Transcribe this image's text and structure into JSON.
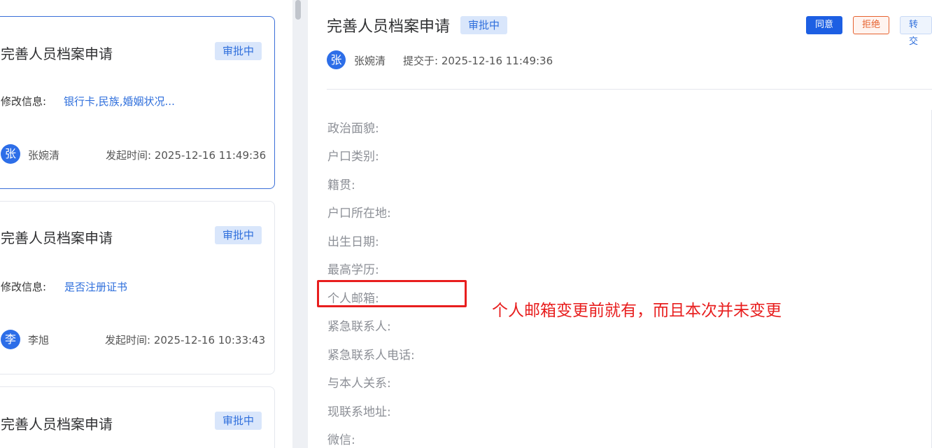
{
  "cards": [
    {
      "title": "完善人员档案申请",
      "status": "审批中",
      "info_label": "修改信息:",
      "info_value": "银行卡,民族,婚姻状况...",
      "avatar_char": "张",
      "name": "张婉清",
      "time": "发起时间: 2025-12-16 11:49:36"
    },
    {
      "title": "完善人员档案申请",
      "status": "审批中",
      "info_label": "修改信息:",
      "info_value": "是否注册证书",
      "avatar_char": "李",
      "name": "李旭",
      "time": "发起时间: 2025-12-16 10:33:43"
    },
    {
      "title": "完善人员档案申请",
      "status": "审批中"
    }
  ],
  "detail": {
    "title": "完善人员档案申请",
    "status": "审批中",
    "actions": {
      "agree": "同意",
      "reject": "拒绝",
      "transfer": "转交"
    },
    "submitter_avatar": "张",
    "submitter_name": "张婉清",
    "submit_time": "提交于: 2025-12-16 11:49:36",
    "fields": [
      "政治面貌:",
      "户口类别:",
      "籍贯:",
      "户口所在地:",
      "出生日期:",
      "最高学历:",
      "个人邮箱:",
      "紧急联系人:",
      "紧急联系人电话:",
      "与本人关系:",
      "现联系地址:",
      "微信:"
    ]
  },
  "annotation": "个人邮箱变更前就有，而且本次并未变更",
  "colors": {
    "accent": "#2f6fdc",
    "badge_bg": "#d9e6fb",
    "primary_button": "#1d5fe3",
    "reject": "#e6622f",
    "annotation_red": "#e81e1e"
  }
}
